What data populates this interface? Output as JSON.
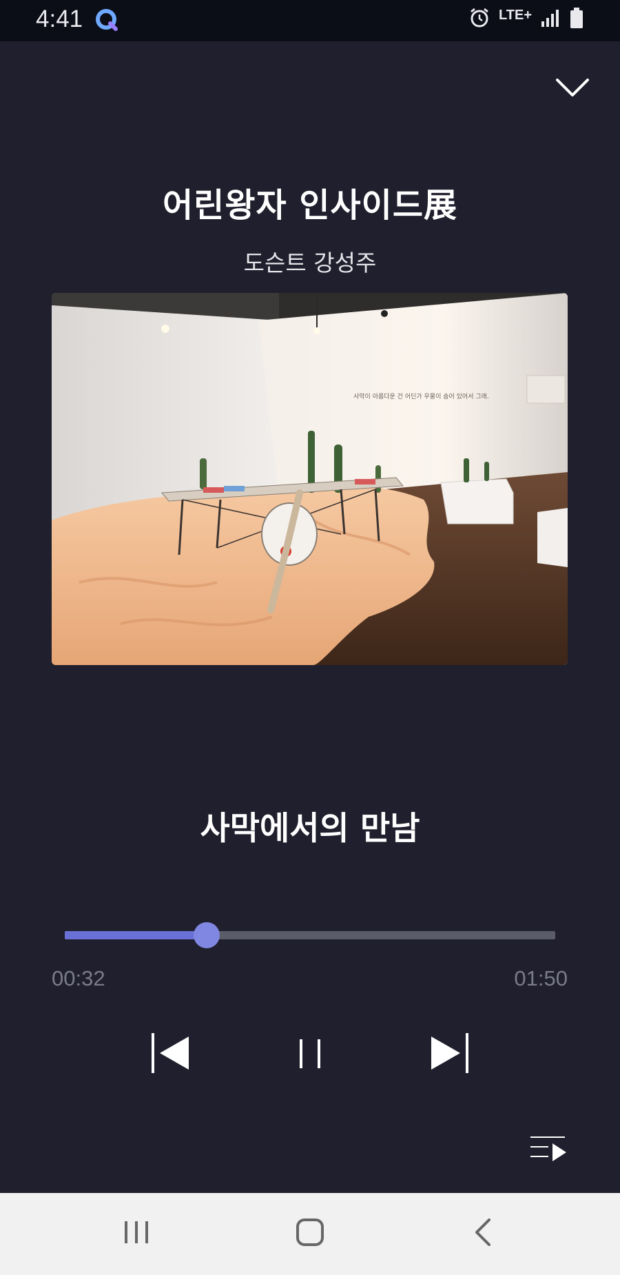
{
  "status_bar": {
    "time": "4:41",
    "network": "LTE+",
    "icons": [
      "quick-app-icon",
      "alarm-icon",
      "signal-icon",
      "battery-icon"
    ]
  },
  "header": {
    "collapse_icon": "chevron-down-icon"
  },
  "exhibition": {
    "title": "어린왕자 인사이드展",
    "docent": "도슨트 강성주"
  },
  "artwork": {
    "wall_text": "사막이 아름다운 건 어딘가 우물이 숨어 있어서 그래."
  },
  "player": {
    "track_title": "사막에서의 만남",
    "current_time": "00:32",
    "total_time": "01:50",
    "progress": 0.29,
    "controls": [
      "previous-icon",
      "pause-icon",
      "next-icon"
    ],
    "playlist_icon": "playlist-icon"
  },
  "nav_bar": {
    "buttons": [
      "recent-apps-icon",
      "home-icon",
      "back-icon"
    ]
  },
  "colors": {
    "background": "#1f1f2d",
    "accent": "#6a71d6",
    "thumb": "#8087e2",
    "track": "#5b5c69",
    "time_text": "#7b7c89"
  }
}
